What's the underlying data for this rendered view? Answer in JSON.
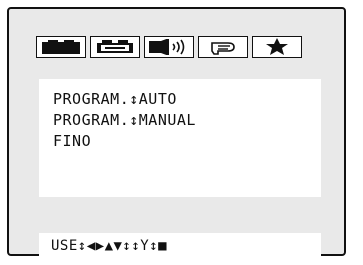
{
  "icon_bar": [
    {
      "icon": "picture-icon-active",
      "active": true
    },
    {
      "icon": "picture-icon"
    },
    {
      "icon": "speaker-icon"
    },
    {
      "icon": "hand-pointer-icon"
    },
    {
      "icon": "star-icon"
    }
  ],
  "menu": {
    "items": [
      {
        "label": "PROGRAM.↕AUTO"
      },
      {
        "label": "PROGRAM.↕MANUAL"
      },
      {
        "label": "FINO"
      }
    ]
  },
  "help": {
    "text": "USE↕◀▶▲▼↕↕Y↕■"
  },
  "colors": {
    "screen_bg": "#e9e9e9",
    "panel_bg": "#ffffff",
    "border": "#111111"
  }
}
